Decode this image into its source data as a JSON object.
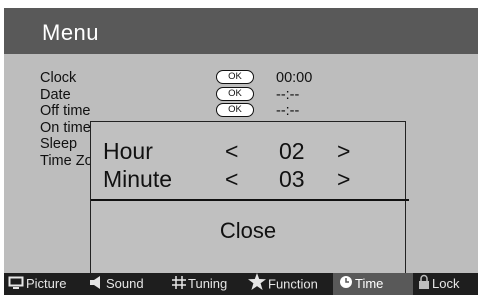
{
  "menu": {
    "title": "Menu"
  },
  "time_menu": {
    "items": [
      {
        "label": "Clock",
        "ok": "OK",
        "value": "00:00"
      },
      {
        "label": "Date",
        "ok": "OK",
        "value": "--:--"
      },
      {
        "label": "Off time",
        "ok": "OK",
        "value": "--:--"
      },
      {
        "label": "On time",
        "ok": "",
        "value": ""
      },
      {
        "label": "Sleep",
        "ok": "",
        "value": ""
      },
      {
        "label": "Time Zone",
        "ok": "",
        "value": ""
      }
    ]
  },
  "dialog": {
    "hour_label": "Hour",
    "hour_value": "02",
    "minute_label": "Minute",
    "minute_value": "03",
    "decrease_symbol": "<",
    "increase_symbol": ">",
    "close_label": "Close"
  },
  "tabs": [
    {
      "label": "Picture",
      "icon": "monitor-icon"
    },
    {
      "label": "Sound",
      "icon": "speaker-icon"
    },
    {
      "label": "Tuning",
      "icon": "grid-icon"
    },
    {
      "label": "Function",
      "icon": "star-icon"
    },
    {
      "label": "Time",
      "icon": "clock-icon",
      "active": true
    },
    {
      "label": "Lock",
      "icon": "lock-icon"
    }
  ],
  "colors": {
    "active_tab": "#595959",
    "title_bar": "#595959",
    "panel": "#bdbdbd",
    "tab_bar": "#1e1e1e"
  }
}
